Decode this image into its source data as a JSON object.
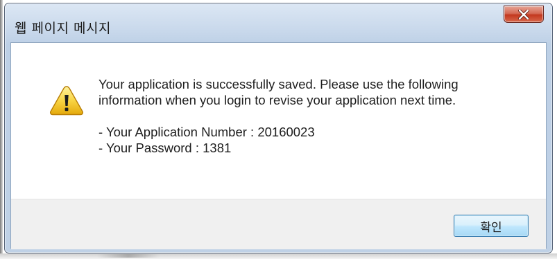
{
  "dialog": {
    "title": "웹 페이지 메시지",
    "close_label": "X",
    "icon": "warning-icon",
    "message": {
      "line1": "Your application is successfully saved. Please use the following",
      "line2": "information when you login to revise your application next time.",
      "app_number": "- Your Application Number : 20160023",
      "password": "- Your Password : 1381"
    },
    "ok_label": "확인"
  },
  "colors": {
    "frame": "#bfd1e6",
    "close_button": "#c3381f",
    "ok_button": "#bee6fd",
    "button_bar": "#f0f0f0"
  }
}
